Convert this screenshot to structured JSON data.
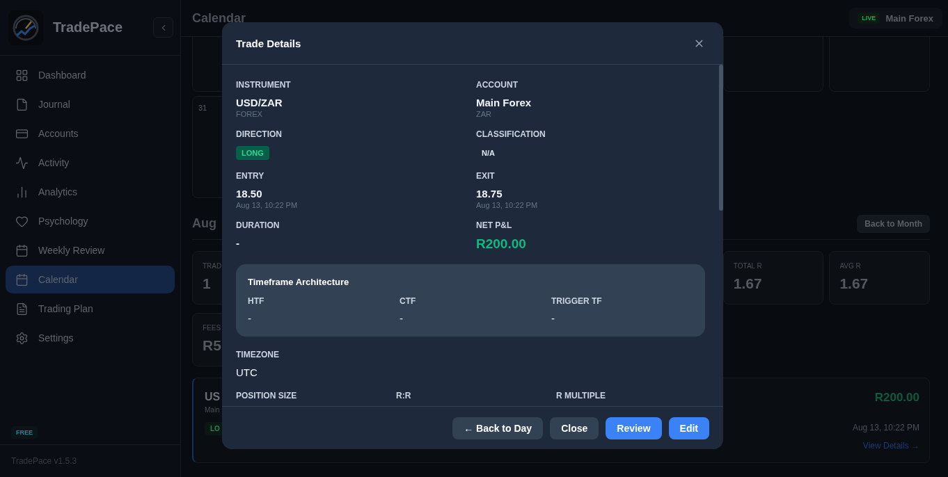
{
  "sidebar": {
    "brand": "TradePace",
    "nav": [
      {
        "label": "Dashboard",
        "selected": false
      },
      {
        "label": "Journal",
        "selected": false
      },
      {
        "label": "Accounts",
        "selected": false
      },
      {
        "label": "Activity",
        "selected": false
      },
      {
        "label": "Analytics",
        "selected": false
      },
      {
        "label": "Psychology",
        "selected": false
      },
      {
        "label": "Weekly Review",
        "selected": false
      },
      {
        "label": "Calendar",
        "selected": true
      },
      {
        "label": "Trading Plan",
        "selected": false
      },
      {
        "label": "Settings",
        "selected": false
      }
    ],
    "plan_badge": "FREE",
    "version": "TradePace v1.5.3"
  },
  "header": {
    "title": "Calendar",
    "account": {
      "status": "LIVE",
      "name": "Main Forex"
    }
  },
  "calendar": {
    "day": "31",
    "day_heading": "Aug",
    "back_button": "Back to Month",
    "stats": [
      {
        "label": "TRAD",
        "value": "1"
      },
      {
        "label": "TOTAL R",
        "value": "1.67"
      },
      {
        "label": "AVG R",
        "value": "1.67"
      },
      {
        "label": "FEES",
        "value": "R5"
      }
    ],
    "trade_card": {
      "symbol": "US",
      "account": "Main",
      "direction": "LO",
      "pnl": "R200.00",
      "time": "Aug 13, 10:22 PM",
      "link": "View Details →"
    }
  },
  "modal": {
    "title": "Trade Details",
    "fields": [
      {
        "kind": "text",
        "label": "INSTRUMENT",
        "value": "USD/ZAR",
        "sub": "FOREX"
      },
      {
        "kind": "text",
        "label": "ACCOUNT",
        "value": "Main Forex",
        "sub": "ZAR"
      },
      {
        "kind": "badge",
        "label": "DIRECTION",
        "value": "LONG",
        "color": "#065f46"
      },
      {
        "kind": "badge",
        "label": "CLASSIFICATION",
        "value": "N/A",
        "color": "#1e293b"
      },
      {
        "kind": "text",
        "label": "ENTRY",
        "value": "18.50",
        "sub": "Aug 13, 10:22 PM"
      },
      {
        "kind": "text",
        "label": "EXIT",
        "value": "18.75",
        "sub": "Aug 13, 10:22 PM"
      },
      {
        "kind": "text",
        "label": "DURATION",
        "value": "-"
      },
      {
        "kind": "pnl",
        "label": "NET P&L",
        "value": "R200.00"
      }
    ],
    "timeframe": {
      "title": "Timeframe Architecture",
      "items": [
        {
          "label": "HTF",
          "value": "-"
        },
        {
          "label": "CTF",
          "value": "-"
        },
        {
          "label": "TRIGGER TF",
          "value": "-"
        }
      ]
    },
    "timezone": {
      "label": "TIMEZONE",
      "value": "UTC"
    },
    "cut_labels": [
      "POSITION SIZE",
      "R:R",
      "R MULTIPLE"
    ],
    "buttons": [
      {
        "label": "← Back to Day",
        "kind": "secondary"
      },
      {
        "label": "Close",
        "kind": "secondary"
      },
      {
        "label": "Review",
        "kind": "primary"
      },
      {
        "label": "Edit",
        "kind": "primary"
      }
    ]
  }
}
